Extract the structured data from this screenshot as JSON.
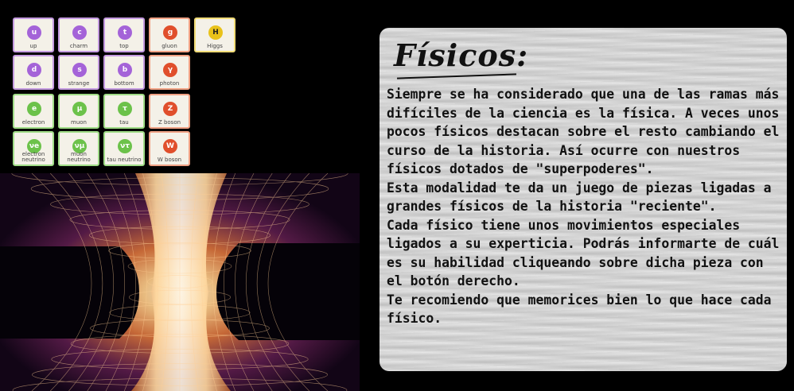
{
  "particles": [
    {
      "symbol": "u",
      "name": "up",
      "group": "quark"
    },
    {
      "symbol": "c",
      "name": "charm",
      "group": "quark"
    },
    {
      "symbol": "t",
      "name": "top",
      "group": "quark"
    },
    {
      "symbol": "g",
      "name": "gluon",
      "group": "boson"
    },
    {
      "symbol": "H",
      "name": "Higgs",
      "group": "higgs"
    },
    {
      "symbol": "d",
      "name": "down",
      "group": "quark"
    },
    {
      "symbol": "s",
      "name": "strange",
      "group": "quark"
    },
    {
      "symbol": "b",
      "name": "bottom",
      "group": "quark"
    },
    {
      "symbol": "γ",
      "name": "photon",
      "group": "boson"
    },
    {
      "symbol": "e",
      "name": "electron",
      "group": "lepton"
    },
    {
      "symbol": "μ",
      "name": "muon",
      "group": "lepton"
    },
    {
      "symbol": "τ",
      "name": "tau",
      "group": "lepton"
    },
    {
      "symbol": "Z",
      "name": "Z boson",
      "group": "boson"
    },
    {
      "symbol": "νe",
      "name": "electron neutrino",
      "group": "lepton"
    },
    {
      "symbol": "νμ",
      "name": "muon neutrino",
      "group": "lepton"
    },
    {
      "symbol": "ντ",
      "name": "tau neutrino",
      "group": "lepton"
    },
    {
      "symbol": "W",
      "name": "W boson",
      "group": "boson"
    }
  ],
  "panel": {
    "title": "Físicos:",
    "body": "Siempre se ha considerado que una de las ramas más difíciles de la ciencia es la física. A veces unos pocos físicos destacan sobre el resto cambiando el curso de la historia. Así ocurre con nuestros físicos dotados de \"superpoderes\".\nEsta modalidad te da un juego de piezas ligadas a grandes físicos de la historia \"reciente\".\nCada físico tiene unos movimientos especiales ligados a su experticia. Podrás informarte de cuál es su habilidad cliqueando sobre dicha pieza con el botón derecho.\nTe recomiendo que memorices bien lo que hace cada físico."
  },
  "colors": {
    "quark": "#a463d8",
    "lepton": "#6cc24a",
    "boson": "#e04f2c",
    "higgs": "#e9c21a",
    "wormhole_glow": "#ffd9a0"
  }
}
